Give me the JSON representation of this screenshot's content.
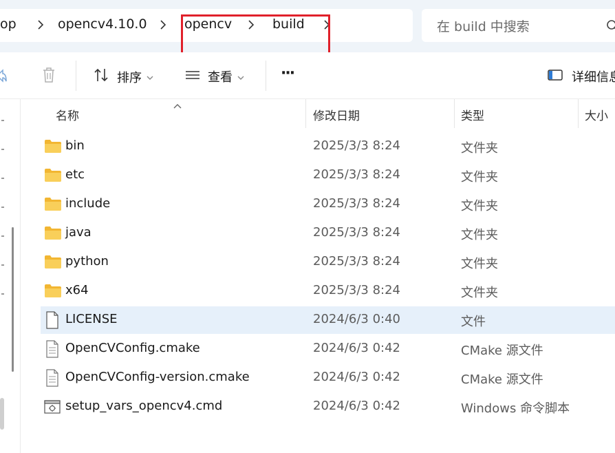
{
  "breadcrumbs": [
    "op",
    "opencv4.10.0",
    "opencv",
    "build"
  ],
  "search": {
    "placeholder": "在 build 中搜索"
  },
  "toolbar": {
    "sort_label": "排序",
    "view_label": "查看",
    "more_label": "···",
    "details_label": "详细信息"
  },
  "columns": {
    "name": "名称",
    "date": "修改日期",
    "type": "类型",
    "size": "大小"
  },
  "files": [
    {
      "name": "bin",
      "date": "2025/3/3 8:24",
      "type": "文件夹",
      "icon": "folder-icon"
    },
    {
      "name": "etc",
      "date": "2025/3/3 8:24",
      "type": "文件夹",
      "icon": "folder-icon"
    },
    {
      "name": "include",
      "date": "2025/3/3 8:24",
      "type": "文件夹",
      "icon": "folder-icon"
    },
    {
      "name": "java",
      "date": "2025/3/3 8:24",
      "type": "文件夹",
      "icon": "folder-icon"
    },
    {
      "name": "python",
      "date": "2025/3/3 8:24",
      "type": "文件夹",
      "icon": "folder-icon"
    },
    {
      "name": "x64",
      "date": "2025/3/3 8:24",
      "type": "文件夹",
      "icon": "folder-icon"
    },
    {
      "name": "LICENSE",
      "date": "2024/6/3 0:40",
      "type": "文件",
      "icon": "file-icon"
    },
    {
      "name": "OpenCVConfig.cmake",
      "date": "2024/6/3 0:42",
      "type": "CMake 源文件",
      "icon": "text-file-icon"
    },
    {
      "name": "OpenCVConfig-version.cmake",
      "date": "2024/6/3 0:42",
      "type": "CMake 源文件",
      "icon": "text-file-icon"
    },
    {
      "name": "setup_vars_opencv4.cmd",
      "date": "2024/6/3 0:42",
      "type": "Windows 命令脚本",
      "icon": "script-file-icon"
    }
  ],
  "colors": {
    "highlight": "#e0202a",
    "selected_row": "#e6f0fa",
    "folder": "#f6c445"
  }
}
